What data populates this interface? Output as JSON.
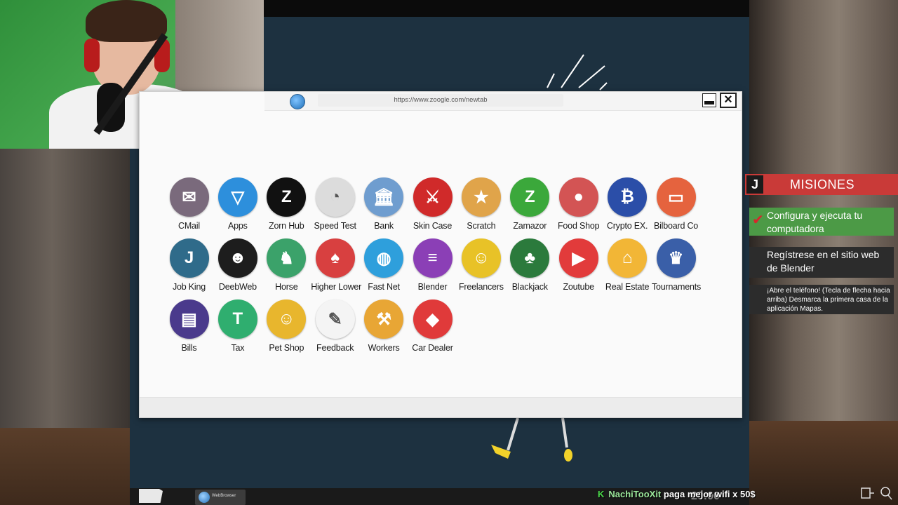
{
  "browser": {
    "url": "https://www.zoogle.com/newtab",
    "apps_row1": [
      {
        "label": "CMail",
        "icon": "mail-icon",
        "bg": "#7a6a7c"
      },
      {
        "label": "Apps",
        "icon": "apps-triangle-icon",
        "bg": "#2d8fdc"
      },
      {
        "label": "Zorn Hub",
        "icon": "zorn-hub-icon",
        "bg": "#111111"
      },
      {
        "label": "Speed Test",
        "icon": "speedometer-icon",
        "bg": "#dcdcdc"
      },
      {
        "label": "Bank",
        "icon": "bank-icon",
        "bg": "#6f9dcf"
      },
      {
        "label": "Skin Case",
        "icon": "knife-icon",
        "bg": "#d02a2a"
      },
      {
        "label": "Scratch",
        "icon": "scratch-ticket-icon",
        "bg": "#e0a44a"
      },
      {
        "label": "Zamazor",
        "icon": "zamazor-icon",
        "bg": "#3ba83b"
      },
      {
        "label": "Food Shop",
        "icon": "burger-icon",
        "bg": "#d35454"
      },
      {
        "label": "Crypto EX.",
        "icon": "crypto-laptop-icon",
        "bg": "#2b4ea8"
      },
      {
        "label": "Bilboard Co",
        "icon": "billboard-icon",
        "bg": "#e5633e"
      }
    ],
    "apps_row2": [
      {
        "label": "Job King",
        "icon": "job-icon",
        "bg": "#2f6b8a"
      },
      {
        "label": "DeebWeb",
        "icon": "mask-icon",
        "bg": "#1d1d1d"
      },
      {
        "label": "Horse",
        "icon": "horse-icon",
        "bg": "#3ba26a"
      },
      {
        "label": "Higher Lower",
        "icon": "playing-card-icon",
        "bg": "#d84040"
      },
      {
        "label": "Fast Net",
        "icon": "globe-icon",
        "bg": "#2e9fdc"
      },
      {
        "label": "Blender",
        "icon": "sliders-icon",
        "bg": "#8b3fb6"
      },
      {
        "label": "Freelancers",
        "icon": "freelancer-icon",
        "bg": "#e8c227"
      },
      {
        "label": "Blackjack",
        "icon": "cards-icon",
        "bg": "#2b7a3c"
      },
      {
        "label": "Zoutube",
        "icon": "play-icon",
        "bg": "#e23b3b"
      },
      {
        "label": "Real Estate",
        "icon": "house-icon",
        "bg": "#f2b636"
      },
      {
        "label": "Tournaments",
        "icon": "trophy-icon",
        "bg": "#3a5fa8"
      }
    ],
    "apps_row3": [
      {
        "label": "Bills",
        "icon": "bill-icon",
        "bg": "#4a3a8c"
      },
      {
        "label": "Tax",
        "icon": "tax-icon",
        "bg": "#2fae6f"
      },
      {
        "label": "Pet Shop",
        "icon": "dog-icon",
        "bg": "#e8b62d"
      },
      {
        "label": "Feedback",
        "icon": "feedback-icon",
        "bg": "#f4f4f4"
      },
      {
        "label": "Workers",
        "icon": "worker-icon",
        "bg": "#e8a635"
      },
      {
        "label": "Car Dealer",
        "icon": "car-icon",
        "bg": "#e03a3a"
      }
    ]
  },
  "missions": {
    "key": "J",
    "title": "MISIONES",
    "items": [
      {
        "text": "Configura y ejecuta tu computadora",
        "done": true
      },
      {
        "text": "Regístrese en el sitio web de Blender",
        "done": false
      },
      {
        "text": "¡Abre el teléfono! (Tecla de flecha hacia arriba) Desmarca la primera casa de la aplicación Mapas.",
        "done": false
      }
    ]
  },
  "taskbar": {
    "browser_label": "WebBrowser",
    "clock": "20:00"
  },
  "chat": {
    "user": "NachiTooXit",
    "message": "paga mejor wifi x 50$"
  }
}
